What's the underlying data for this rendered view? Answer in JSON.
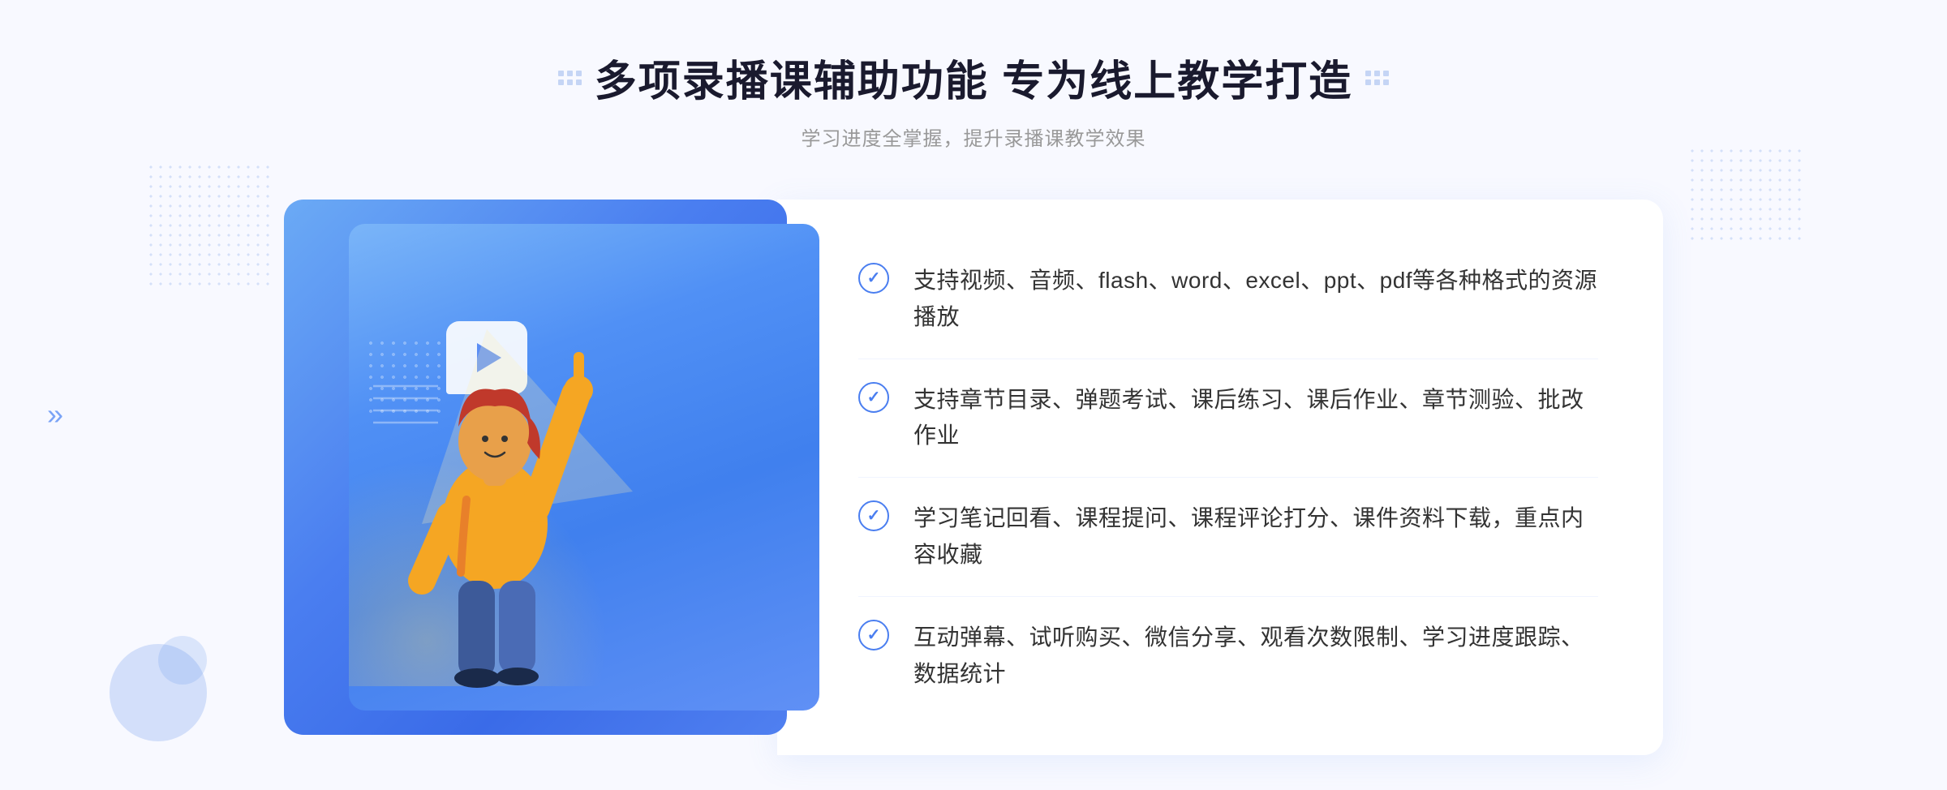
{
  "header": {
    "main_title": "多项录播课辅助功能 专为线上教学打造",
    "sub_title": "学习进度全掌握，提升录播课教学效果"
  },
  "features": [
    {
      "id": "feature-1",
      "text": "支持视频、音频、flash、word、excel、ppt、pdf等各种格式的资源播放"
    },
    {
      "id": "feature-2",
      "text": "支持章节目录、弹题考试、课后练习、课后作业、章节测验、批改作业"
    },
    {
      "id": "feature-3",
      "text": "学习笔记回看、课程提问、课程评论打分、课件资料下载，重点内容收藏"
    },
    {
      "id": "feature-4",
      "text": "互动弹幕、试听购买、微信分享、观看次数限制、学习进度跟踪、数据统计"
    }
  ],
  "decorations": {
    "chevron_left": "»",
    "dot_grid_count": 6
  }
}
